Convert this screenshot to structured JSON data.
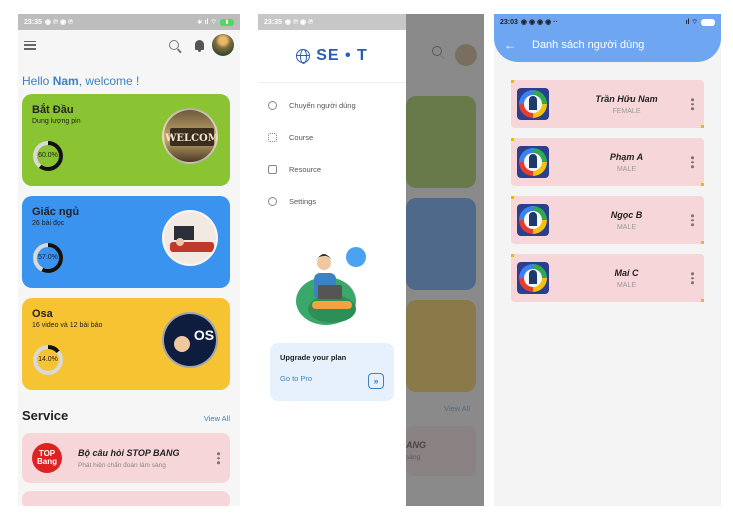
{
  "phone1": {
    "status": {
      "time": "23:35"
    },
    "greeting": {
      "prefix": "Hello ",
      "name": "Nam",
      "suffix": ", welcome !"
    },
    "cards": [
      {
        "title": "Bắt Đầu",
        "subtitle": "Dung lượng pin",
        "percent": "60.0%",
        "percent_value": 60,
        "color": "#8ac432",
        "image_text": "WELCOM"
      },
      {
        "title": "Giấc ngủ",
        "subtitle": "26 bài đọc",
        "percent": "57.0%",
        "percent_value": 57,
        "color": "#3b93f0"
      },
      {
        "title": "Osa",
        "subtitle": "16 video và 12 bài báo",
        "percent": "14.0%",
        "percent_value": 14,
        "color": "#f6c433",
        "image_text": "OS"
      }
    ],
    "service": {
      "title": "Service",
      "view_all": "View All"
    },
    "service_items": [
      {
        "logo": "TOP Bang",
        "title": "Bộ câu hỏi STOP BANG",
        "subtitle": "Phát hiện chẩn đoán lâm sàng"
      }
    ]
  },
  "phone2": {
    "status": {
      "time": "23:35"
    },
    "brand": "SE • T",
    "menu": [
      {
        "label": "Chuyển người dùng",
        "icon": "user-icon"
      },
      {
        "label": "Course",
        "icon": "grid-icon"
      },
      {
        "label": "Resource",
        "icon": "folder-icon"
      },
      {
        "label": "Settings",
        "icon": "gear-icon"
      }
    ],
    "upgrade": {
      "title": "Upgrade your plan",
      "link": "Go to Pro",
      "button": "»"
    },
    "behind": {
      "view_all": "View All",
      "svc_title": "ANG",
      "svc_sub": "sàng"
    }
  },
  "phone3": {
    "status": {
      "time": "23:03"
    },
    "title": "Danh sách người dùng",
    "users": [
      {
        "name": "Trần Hữu Nam",
        "gender": "FEMALE"
      },
      {
        "name": "Phạm A",
        "gender": "MALE"
      },
      {
        "name": "Ngọc B",
        "gender": "MALE"
      },
      {
        "name": "Mai C",
        "gender": "MALE"
      }
    ]
  }
}
